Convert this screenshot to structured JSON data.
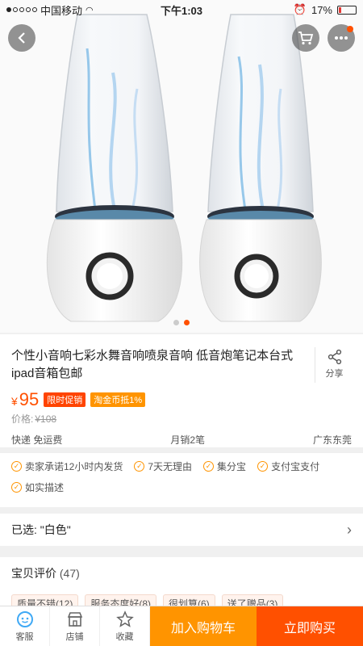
{
  "status_bar": {
    "carrier": "中国移动",
    "time": "下午1:03",
    "battery": "17%",
    "battery_level": 0.17
  },
  "hero": {
    "carousel_total": 2,
    "carousel_active": 2
  },
  "product": {
    "title": "个性小音响七彩水舞音响喷泉音响 低音炮笔记本台式ipad音箱包邮",
    "share_label": "分享",
    "currency": "¥",
    "price": "95",
    "tag_promo": "限时促销",
    "tag_coin": "淘金币抵1%",
    "old_price_label": "价格:",
    "old_price": "¥108",
    "shipping": "快递 免运费",
    "monthly_sales": "月销2笔",
    "location": "广东东莞"
  },
  "services": [
    "卖家承诺12小时内发货",
    "7天无理由",
    "集分宝",
    "支付宝支付",
    "如实描述"
  ],
  "selection": {
    "label": "已选: \"白色\""
  },
  "reviews": {
    "title": "宝贝评价",
    "count": "(47)",
    "tags": [
      "质量不错(12)",
      "服务态度好(8)",
      "很划算(6)",
      "送了赠品(3)"
    ]
  },
  "bottom_bar": {
    "service": "客服",
    "shop": "店铺",
    "favorite": "收藏",
    "add_to_cart": "加入购物车",
    "buy_now": "立即购买"
  },
  "colors": {
    "accent": "#ff5000",
    "cart": "#ff9400",
    "service_icon": "#3fa9f5"
  }
}
